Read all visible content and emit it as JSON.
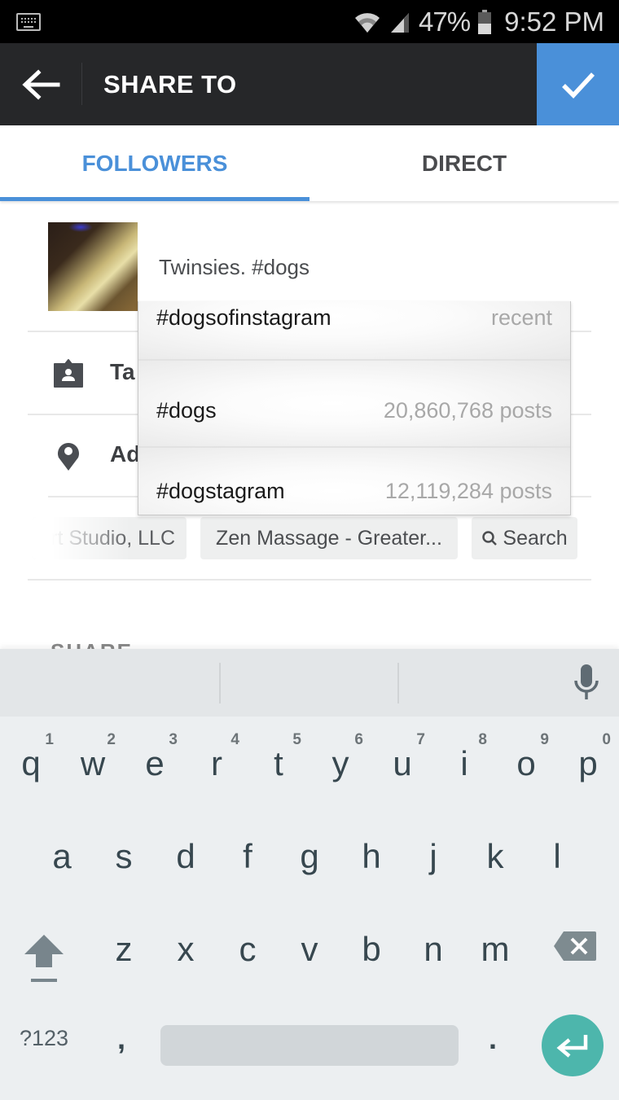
{
  "status_bar": {
    "keyboard_indicator_icon": "keyboard-icon",
    "wifi_icon": "wifi-icon",
    "signal_icon": "cellular-signal-icon",
    "battery_percent": "47%",
    "battery_level": 0.47,
    "time": "9:52 PM"
  },
  "header": {
    "back_icon": "arrow-left-icon",
    "title": "SHARE TO",
    "confirm_icon": "checkmark-icon",
    "accent_color": "#4a90d9",
    "background_color": "#262729"
  },
  "tabs": [
    {
      "label": "FOLLOWERS",
      "active": true
    },
    {
      "label": "DIRECT",
      "active": false
    }
  ],
  "post": {
    "caption": "Twinsies. #dogs"
  },
  "options": {
    "tag_people": {
      "icon": "tag-person-icon",
      "label_visible": "Ta"
    },
    "add_location": {
      "icon": "location-pin-icon",
      "label_visible": "Ad"
    }
  },
  "location_chips": [
    {
      "label": "rt Studio, LLC"
    },
    {
      "label": "Zen Massage - Greater..."
    },
    {
      "label": "Search",
      "icon": "search-icon"
    }
  ],
  "share_heading": "SHARE",
  "hashtag_suggestions": [
    {
      "tag": "#dogsofinstagram",
      "meta": "recent"
    },
    {
      "tag": "#dogs",
      "meta": "20,860,768 posts"
    },
    {
      "tag": "#dogstagram",
      "meta": "12,119,284 posts"
    }
  ],
  "keyboard": {
    "mic_icon": "microphone-icon",
    "row1": [
      {
        "key": "q",
        "hint": "1"
      },
      {
        "key": "w",
        "hint": "2"
      },
      {
        "key": "e",
        "hint": "3"
      },
      {
        "key": "r",
        "hint": "4"
      },
      {
        "key": "t",
        "hint": "5"
      },
      {
        "key": "y",
        "hint": "6"
      },
      {
        "key": "u",
        "hint": "7"
      },
      {
        "key": "i",
        "hint": "8"
      },
      {
        "key": "o",
        "hint": "9"
      },
      {
        "key": "p",
        "hint": "0"
      }
    ],
    "row2": [
      "a",
      "s",
      "d",
      "f",
      "g",
      "h",
      "j",
      "k",
      "l"
    ],
    "row3": [
      "z",
      "x",
      "c",
      "v",
      "b",
      "n",
      "m"
    ],
    "shift_icon": "shift-icon",
    "delete_icon": "backspace-icon",
    "symbols_label": "?123",
    "comma": ",",
    "period": ".",
    "enter_icon": "enter-icon",
    "enter_color": "#4db6ac"
  }
}
